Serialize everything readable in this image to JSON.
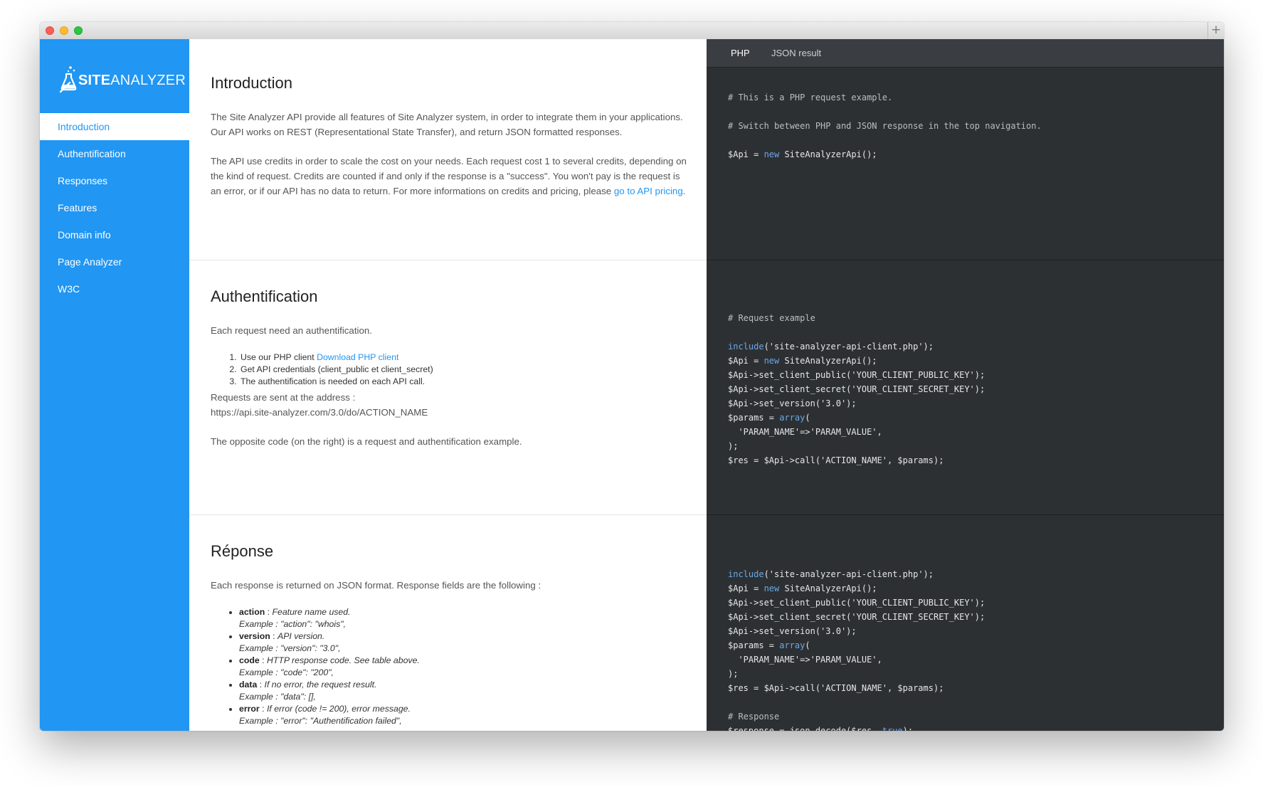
{
  "window": {
    "new_tab_label": "+"
  },
  "sidebar": {
    "logo": {
      "bold": "SITE",
      "light": "ANALYZER"
    },
    "items": [
      {
        "label": "Introduction",
        "active": true
      },
      {
        "label": "Authentification",
        "active": false
      },
      {
        "label": "Responses",
        "active": false
      },
      {
        "label": "Features",
        "active": false
      },
      {
        "label": "Domain info",
        "active": false
      },
      {
        "label": "Page Analyzer",
        "active": false
      },
      {
        "label": "W3C",
        "active": false
      }
    ]
  },
  "intro": {
    "title": "Introduction",
    "p1": "The Site Analyzer API provide all features of Site Analyzer system, in order to integrate them in your applications. Our API works on REST (Representational State Transfer), and return JSON formatted responses.",
    "p2": "The API use credits in order to scale the cost on your needs. Each request cost 1 to several credits, depending on the kind of request. Credits are counted if and only if the response is a \"success\". You won't pay is the request is an error, or if our API has no data to return. For more informations on credits and pricing, please ",
    "p2_link": "go to API pricing",
    "p2_end": "."
  },
  "auth": {
    "title": "Authentification",
    "lead": "Each request need an authentification.",
    "steps": [
      {
        "text": "Use our PHP client ",
        "link": "Download PHP client"
      },
      {
        "text": "Get API credentials (client_public et client_secret)",
        "link": ""
      },
      {
        "text": "The authentification is needed on each API call.",
        "link": ""
      }
    ],
    "address_label": "Requests are sent at the address :",
    "address": "https://api.site-analyzer.com/3.0/do/ACTION_NAME",
    "note": "The opposite code (on the right) is a request and authentification example."
  },
  "response": {
    "title": "Réponse",
    "lead": "Each response is returned on JSON format. Response fields are the following :",
    "fields": [
      {
        "name": "action",
        "desc": "Feature name used.",
        "example": "Example : \"action\": \"whois\","
      },
      {
        "name": "version",
        "desc": "API version.",
        "example": "Example : \"version\": \"3.0\","
      },
      {
        "name": "code",
        "desc": "HTTP response code. See table above.",
        "example": "Example : \"code\": \"200\","
      },
      {
        "name": "data",
        "desc": "If no error, the request result.",
        "example": "Example : \"data\": [],"
      },
      {
        "name": "error",
        "desc": "If error (code != 200), error message.",
        "example": "Example : \"error\": \"Authentification failed\","
      }
    ]
  },
  "code_panel": {
    "tabs": [
      {
        "label": "PHP",
        "active": true
      },
      {
        "label": "JSON result",
        "active": false
      }
    ],
    "block1": [
      "# This is a PHP request example.",
      "",
      "# Switch between PHP and JSON response in the top navigation.",
      "",
      "$Api = new SiteAnalyzerApi();"
    ],
    "block2": [
      "# Request example",
      "",
      "include('site-analyzer-api-client.php');",
      "$Api = new SiteAnalyzerApi();",
      "$Api->set_client_public('YOUR_CLIENT_PUBLIC_KEY');",
      "$Api->set_client_secret('YOUR_CLIENT_SECRET_KEY');",
      "$Api->set_version('3.0');",
      "$params = array(",
      "  'PARAM_NAME'=>'PARAM_VALUE',",
      ");",
      "$res = $Api->call('ACTION_NAME', $params);"
    ],
    "block3": [
      "include('site-analyzer-api-client.php');",
      "$Api = new SiteAnalyzerApi();",
      "$Api->set_client_public('YOUR_CLIENT_PUBLIC_KEY');",
      "$Api->set_client_secret('YOUR_CLIENT_SECRET_KEY');",
      "$Api->set_version('3.0');",
      "$params = array(",
      "  'PARAM_NAME'=>'PARAM_VALUE',",
      ");",
      "$res = $Api->call('ACTION_NAME', $params);",
      "",
      "# Response",
      "$response = json_decode($res, true);"
    ]
  },
  "colors": {
    "accent": "#2196f3",
    "code_bg": "#2d3033",
    "code_tabs_bg": "#3a3d41"
  }
}
